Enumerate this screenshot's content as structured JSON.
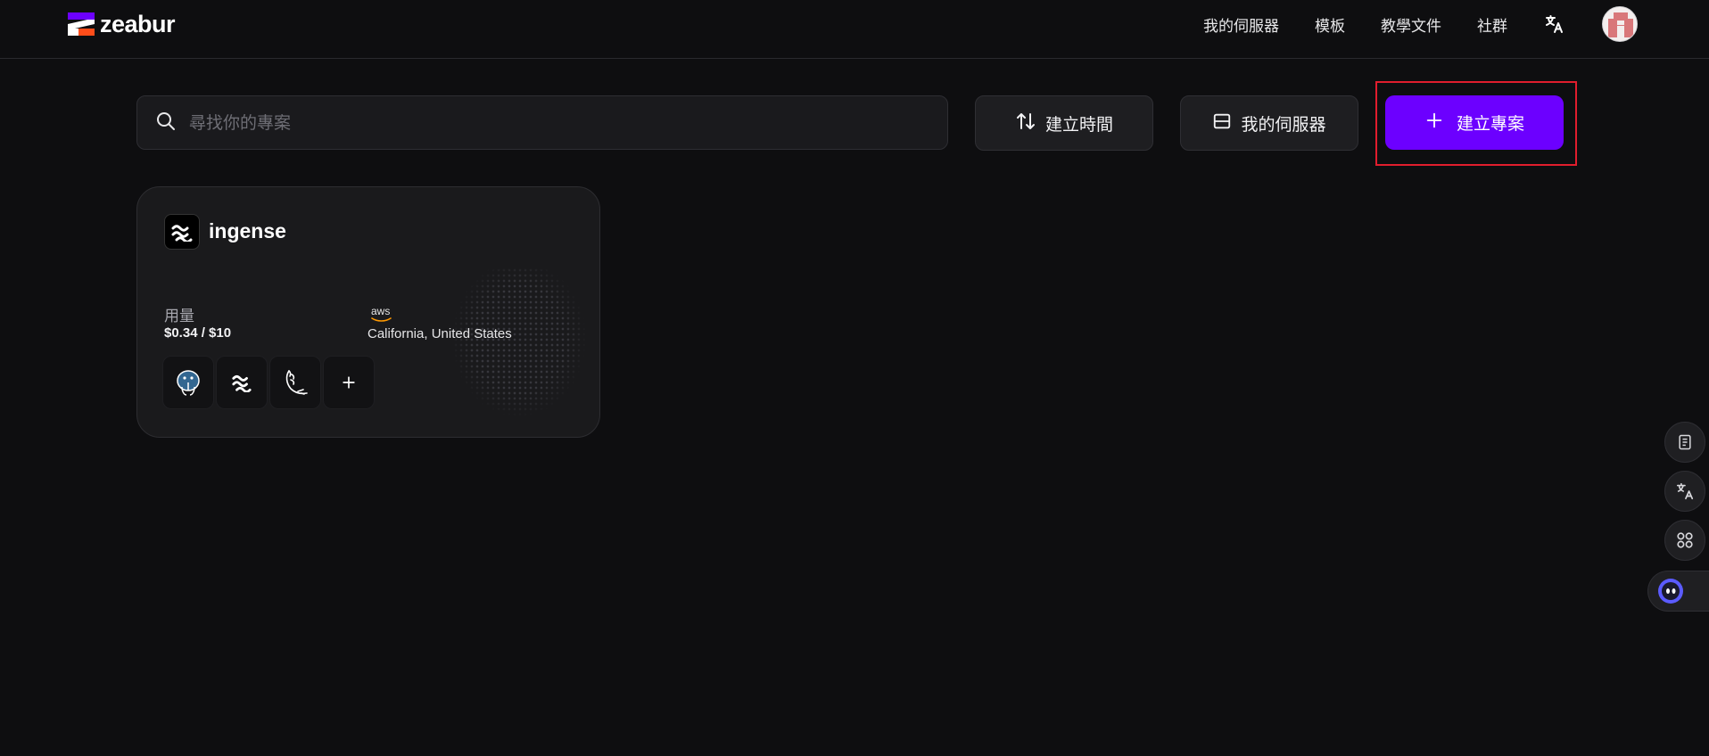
{
  "header": {
    "logo_text": "zeabur",
    "nav": {
      "servers": "我的伺服器",
      "templates": "模板",
      "docs": "教學文件",
      "community": "社群"
    },
    "icons": [
      "translate-icon",
      "avatar"
    ]
  },
  "toolbar": {
    "search_placeholder": "尋找你的專案",
    "sort_label": "建立時間",
    "servers_label": "我的伺服器",
    "create_label": "建立專案"
  },
  "projects": [
    {
      "name": "ingense",
      "usage_label": "用量",
      "usage_value": "$0.34 / $10",
      "provider": "aws",
      "region": "California, United States",
      "services": [
        "postgresql-icon",
        "zeabur-service-icon",
        "flask-icon",
        "add-service"
      ]
    }
  ],
  "floating_tools": [
    "document-icon",
    "translate-icon",
    "apps-icon",
    "assistant-icon"
  ],
  "colors": {
    "background": "#0e0e10",
    "accent": "#6c00ff",
    "highlight": "#e11d2d"
  }
}
